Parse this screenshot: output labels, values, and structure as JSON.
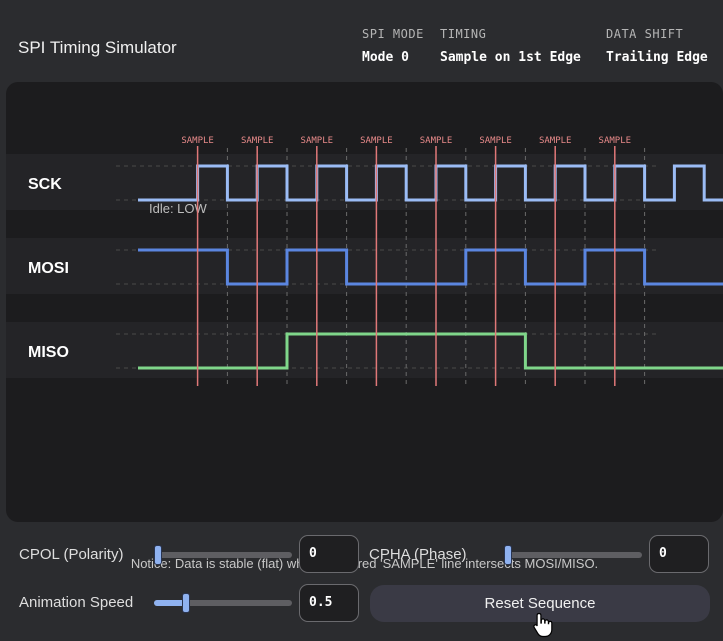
{
  "app": {
    "title": "SPI Timing Simulator"
  },
  "stats": [
    {
      "label": "SPI MODE",
      "value": "Mode 0"
    },
    {
      "label": "TIMING",
      "value": "Sample on 1st Edge"
    },
    {
      "label": "DATA SHIFT",
      "value": "Trailing Edge"
    }
  ],
  "diagram": {
    "sample_label": "SAMPLE",
    "sample_count": 8,
    "idle_label": "Idle: LOW",
    "signals": [
      {
        "name": "SCK",
        "color": "#9bbcf5",
        "levels": [
          0,
          0,
          1,
          0,
          1,
          0,
          1,
          0,
          1,
          0,
          1,
          0,
          1,
          0,
          1,
          0,
          1,
          0,
          1,
          0
        ]
      },
      {
        "name": "MOSI",
        "color": "#5b86e0",
        "levels": [
          1,
          1,
          1,
          0,
          0,
          1,
          1,
          0,
          0,
          0,
          0,
          1,
          1,
          0,
          0,
          1,
          1,
          0,
          0,
          0
        ]
      },
      {
        "name": "MISO",
        "color": "#7fd68a",
        "levels": [
          0,
          0,
          0,
          0,
          0,
          1,
          1,
          1,
          1,
          1,
          1,
          1,
          1,
          0,
          0,
          0,
          0,
          0,
          0,
          0
        ]
      }
    ],
    "colors": {
      "sample_line": "#e07878",
      "sample_text": "#e88a8a",
      "grid": "#6a6a6a",
      "lane": "#242427"
    },
    "notice": "Notice: Data is stable (flat) whenever a red 'SAMPLE' line intersects MOSI/MISO."
  },
  "controls": {
    "cpol": {
      "label": "CPOL (Polarity)",
      "value": "0"
    },
    "cpha": {
      "label": "CPHA (Phase)",
      "value": "0"
    },
    "speed": {
      "label": "Animation Speed",
      "value": "0.5"
    },
    "reset_label": "Reset Sequence"
  }
}
